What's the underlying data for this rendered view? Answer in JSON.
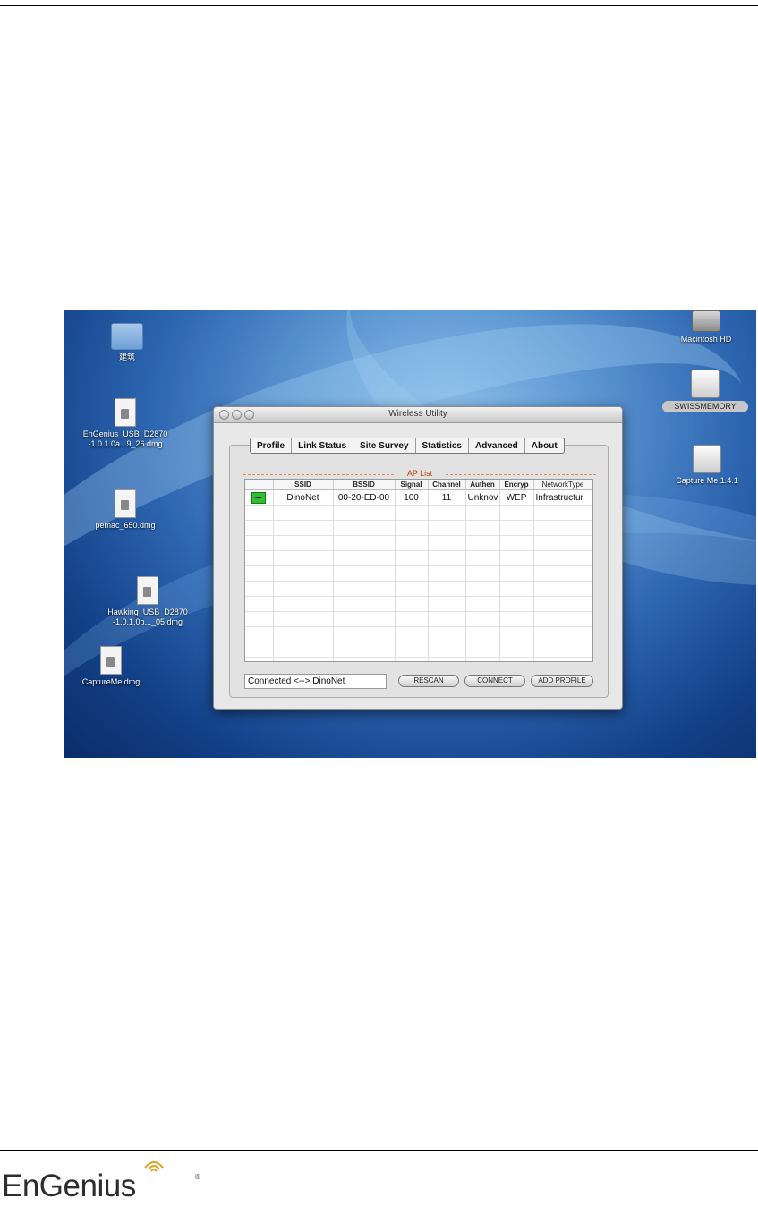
{
  "window": {
    "title": "Wireless Utility",
    "tabs": [
      "Profile",
      "Link Status",
      "Site Survey",
      "Statistics",
      "Advanced",
      "About"
    ],
    "ap_list_title": "AP List",
    "columns": [
      "SSID",
      "BSSID",
      "Signal",
      "Channel",
      "Authen",
      "Encryp",
      "NetworkType"
    ],
    "rows": [
      {
        "ssid": "DinoNet",
        "bssid": "00-20-ED-00",
        "signal": "100",
        "channel": "11",
        "authen": "Unknov",
        "encryp": "WEP",
        "network_type": "Infrastructur"
      }
    ],
    "status": "Connected <--> DinoNet",
    "buttons": {
      "rescan": "RESCAN",
      "connect": "CONNECT",
      "add_profile": "ADD PROFILE"
    }
  },
  "desktop": {
    "folder_label": "建筑",
    "files": [
      {
        "label": "EnGenius_USB_D2870\n-1.0.1.0a...9_26.dmg"
      },
      {
        "label": "pemac_650.dmg"
      },
      {
        "label": "Hawking_USB_D2870\n-1.0.1.0b..._05.dmg"
      },
      {
        "label": "CaptureMe.dmg"
      }
    ],
    "volumes": {
      "hd": "Macintosh HD",
      "usb": "SWISSMEMORY",
      "capture": "Capture Me 1.4.1"
    }
  },
  "footer": {
    "brand": "EnGenius",
    "reg": "®",
    "brand_color": "#2d2d2d",
    "wave_color": "#e0a020"
  }
}
